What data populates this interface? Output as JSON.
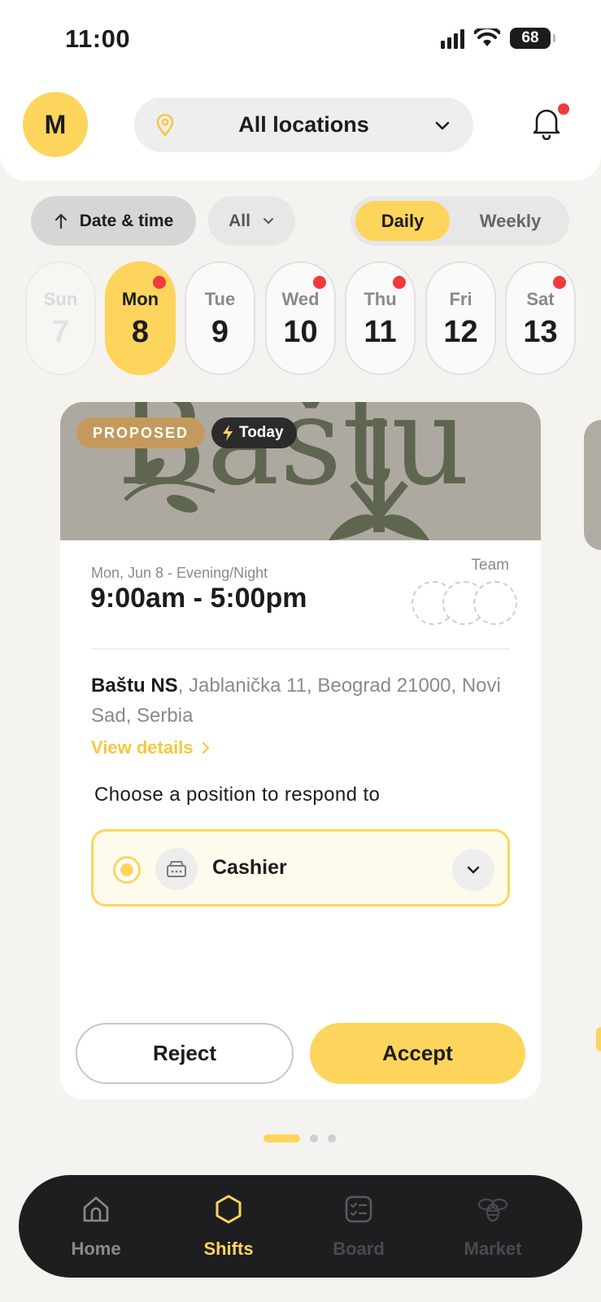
{
  "status_bar": {
    "time": "11:00",
    "battery": "68"
  },
  "header": {
    "avatar_initial": "M",
    "location_select": "All locations",
    "icons": [
      "location-pin-icon",
      "chevron-down-icon",
      "bell-icon"
    ]
  },
  "filters": {
    "sort_label": "Date & time",
    "type_filter": "All",
    "view_toggle": {
      "options": [
        "Daily",
        "Weekly"
      ],
      "selected": "Daily"
    }
  },
  "days": [
    {
      "name": "Sun",
      "date": "7",
      "state": "past",
      "has_dot": false
    },
    {
      "name": "Mon",
      "date": "8",
      "state": "selected",
      "has_dot": true
    },
    {
      "name": "Tue",
      "date": "9",
      "state": "normal",
      "has_dot": false
    },
    {
      "name": "Wed",
      "date": "10",
      "state": "normal",
      "has_dot": true
    },
    {
      "name": "Thu",
      "date": "11",
      "state": "normal",
      "has_dot": true
    },
    {
      "name": "Fri",
      "date": "12",
      "state": "normal",
      "has_dot": false
    },
    {
      "name": "Sat",
      "date": "13",
      "state": "normal",
      "has_dot": true
    }
  ],
  "shift": {
    "status_badge": "PROPOSED",
    "when_badge": "Today",
    "date_line": "Mon, Jun 8 - Evening/Night",
    "time_range": "9:00am - 5:00pm",
    "team_label": "Team",
    "venue_name": "Baštu NS",
    "address": ", Jablanička 11, Beograd 21000, Novi Sad, Serbia",
    "view_details": "View details",
    "choose_prompt": "Choose a position to respond to",
    "position": "Cashier",
    "reject_label": "Reject",
    "accept_label": "Accept"
  },
  "pager": {
    "pages": 3,
    "current": 1
  },
  "tabbar": {
    "items": [
      {
        "label": "Home",
        "icon": "home-icon",
        "active": false
      },
      {
        "label": "Shifts",
        "icon": "hexagon-icon",
        "active": true
      },
      {
        "label": "Board",
        "icon": "board-icon",
        "active": false
      },
      {
        "label": "Market",
        "icon": "bee-icon",
        "active": false
      }
    ]
  },
  "colors": {
    "accent": "#fdd55c",
    "proposed_badge": "#c49a5c",
    "notification_dot": "#ef3b3b",
    "tabbar_bg": "#1e1e20",
    "page_bg": "#f4f3f0"
  }
}
